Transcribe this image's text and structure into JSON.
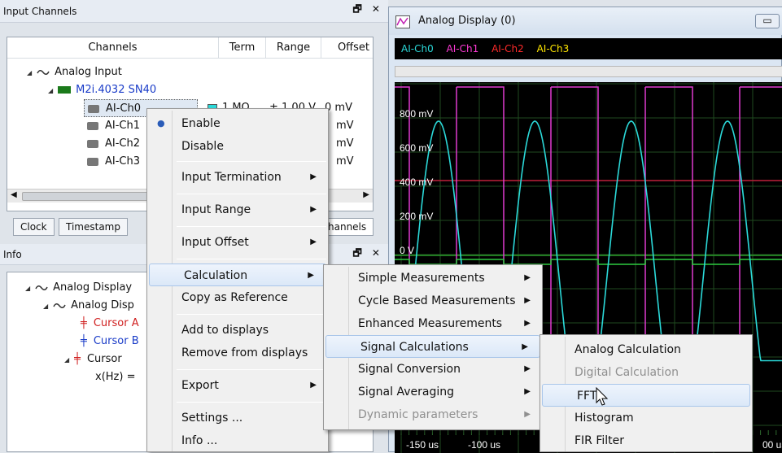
{
  "input_panel": {
    "title": "Input Channels",
    "controls": "🗗 ✕",
    "columns": [
      "Channels",
      "Term",
      "Range",
      "Offset"
    ],
    "tree": {
      "root": "Analog Input",
      "device": "M2i.4032 SN40",
      "channels": [
        "AI-Ch0",
        "AI-Ch1",
        "AI-Ch2",
        "AI-Ch3"
      ]
    },
    "row0": {
      "term": "1 MΩ",
      "range": "± 1.00 V",
      "offset": "0 mV"
    },
    "offset_unit": "mV",
    "tabs": [
      "Clock",
      "Timestamp",
      "hannels"
    ]
  },
  "info_panel": {
    "title": "Info",
    "controls": "🗗 ✕",
    "tree": {
      "root": "Analog Display",
      "child": "Analog Disp",
      "cursor_a": "Cursor A",
      "cursor_b": "Cursor B",
      "cursor_c": "Cursor",
      "xhz": "x(Hz) ="
    }
  },
  "display": {
    "title": "Analog Display (0)",
    "channels": [
      {
        "name": "AI-Ch0",
        "color": "#2bd9d9"
      },
      {
        "name": "AI-Ch1",
        "color": "#ff3ad6"
      },
      {
        "name": "AI-Ch2",
        "color": "#ff2a2a"
      },
      {
        "name": "AI-Ch3",
        "color": "#ffe600"
      }
    ],
    "y_labels": [
      "800 mV",
      "600 mV",
      "400 mV",
      "200 mV",
      "0 V"
    ],
    "x_labels": [
      "-150 us",
      "-100 us",
      "00 us"
    ]
  },
  "context_menu": {
    "items": [
      "Enable",
      "Disable",
      "Input Termination",
      "Input Range",
      "Input Offset",
      "Calculation",
      "Copy as Reference",
      "Add to displays",
      "Remove from displays",
      "Export",
      "Settings ...",
      "Info ..."
    ]
  },
  "calc_menu": {
    "items": [
      "Simple Measurements",
      "Cycle Based Measurements",
      "Enhanced Measurements",
      "Signal Calculations",
      "Signal Conversion",
      "Signal Averaging",
      "Dynamic parameters"
    ]
  },
  "signal_menu": {
    "items": [
      "Analog Calculation",
      "Digital Calculation",
      "FFT",
      "Histogram",
      "FIR Filter"
    ]
  }
}
